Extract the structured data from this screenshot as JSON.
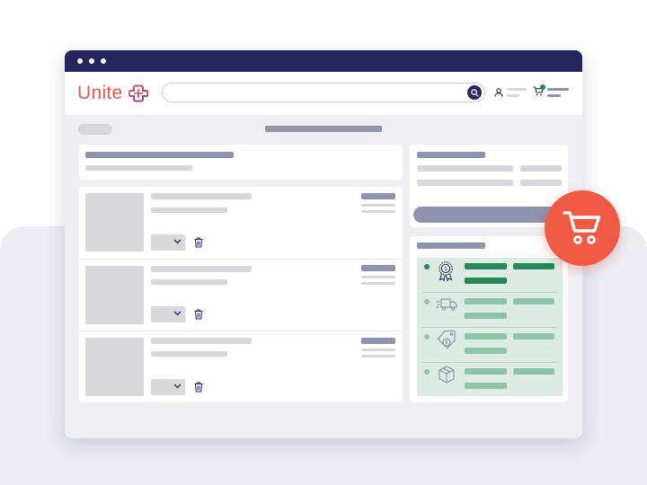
{
  "brand": {
    "logo_text": "Unite"
  },
  "colors": {
    "accent": "#f05a45",
    "navy": "#26265f",
    "green": "#27875a",
    "placeholder": "#d6d6dc",
    "placeholder_dark": "#8f93ad"
  },
  "icons": {
    "search": "search-icon",
    "user": "user-icon",
    "cart": "cart-icon",
    "delete": "trash-icon",
    "award": "award-badge-icon",
    "delivery": "delivery-truck-icon",
    "price": "euro-tag-icon",
    "package": "package-box-icon"
  }
}
